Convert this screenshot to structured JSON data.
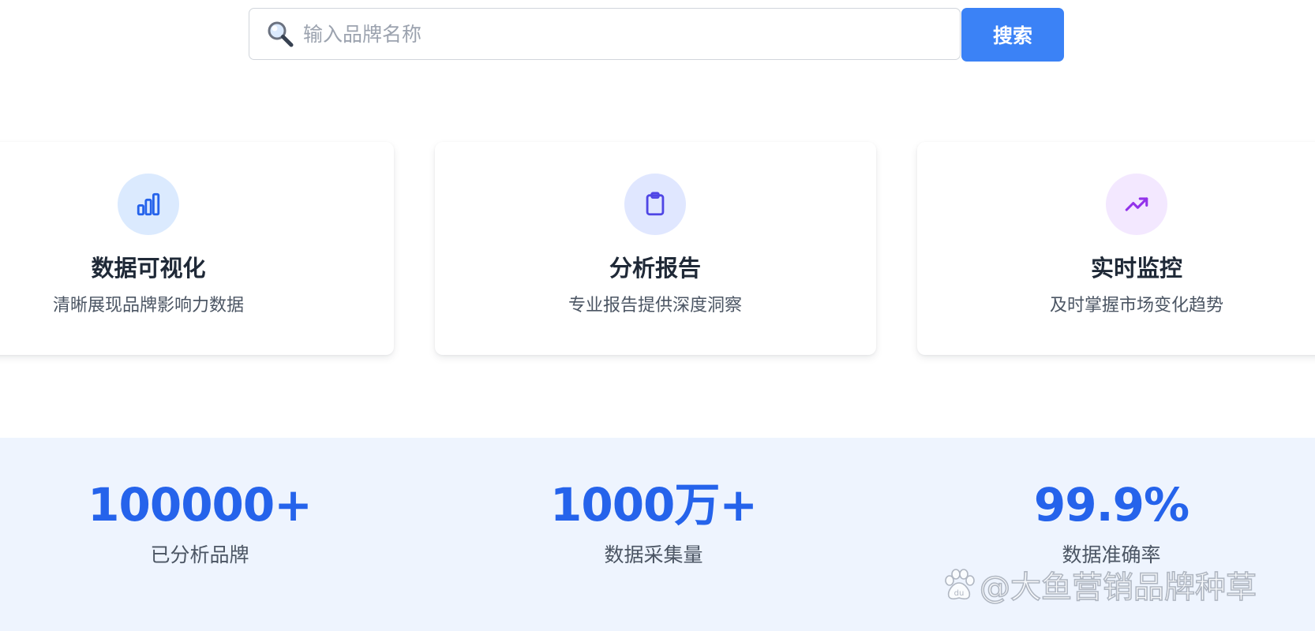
{
  "search": {
    "placeholder": "输入品牌名称",
    "value": "",
    "button_label": "搜索"
  },
  "features": [
    {
      "icon": "bar-chart-icon",
      "icon_color": "#2563eb",
      "icon_bg": "#dbeafe",
      "title": "数据可视化",
      "description": "清晰展现品牌影响力数据"
    },
    {
      "icon": "clipboard-icon",
      "icon_color": "#4f46e5",
      "icon_bg": "#e0e7ff",
      "title": "分析报告",
      "description": "专业报告提供深度洞察"
    },
    {
      "icon": "trending-up-icon",
      "icon_color": "#9333ea",
      "icon_bg": "#f3e8ff",
      "title": "实时监控",
      "description": "及时掌握市场变化趋势"
    }
  ],
  "stats": [
    {
      "value": "100000+",
      "label": "已分析品牌"
    },
    {
      "value": "1000万+",
      "label": "数据采集量"
    },
    {
      "value": "99.9%",
      "label": "数据准确率"
    }
  ],
  "watermark": {
    "text": "@大鱼营销品牌种草",
    "logo_icon": "baidu-paw-icon"
  },
  "colors": {
    "accent": "#3b82f6",
    "stat_value": "#2563eb",
    "stats_background": "#eef4fe"
  }
}
